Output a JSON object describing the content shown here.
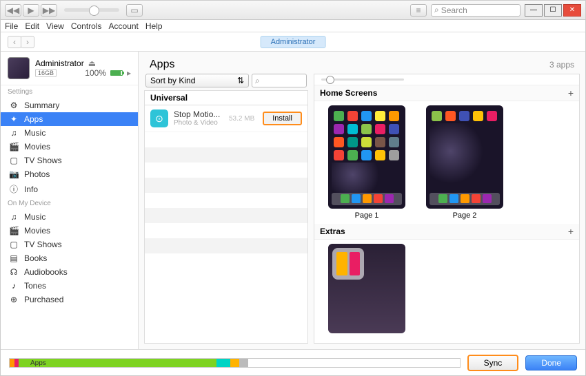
{
  "titlebar": {
    "search_placeholder": "Search"
  },
  "menu": [
    "File",
    "Edit",
    "View",
    "Controls",
    "Account",
    "Help"
  ],
  "context": "Administrator",
  "device": {
    "name": "Administrator",
    "capacity": "16GB",
    "battery": "100%"
  },
  "sidebar": {
    "settings_label": "Settings",
    "settings": [
      {
        "icon": "⚙",
        "label": "Summary"
      },
      {
        "icon": "✦",
        "label": "Apps",
        "active": true
      },
      {
        "icon": "♫",
        "label": "Music"
      },
      {
        "icon": "🎬",
        "label": "Movies"
      },
      {
        "icon": "▢",
        "label": "TV Shows"
      },
      {
        "icon": "📷",
        "label": "Photos"
      },
      {
        "icon": "ⓘ",
        "label": "Info"
      }
    ],
    "device_label": "On My Device",
    "device_items": [
      {
        "icon": "♫",
        "label": "Music"
      },
      {
        "icon": "🎬",
        "label": "Movies"
      },
      {
        "icon": "▢",
        "label": "TV Shows"
      },
      {
        "icon": "▤",
        "label": "Books"
      },
      {
        "icon": "☊",
        "label": "Audiobooks"
      },
      {
        "icon": "♪",
        "label": "Tones"
      },
      {
        "icon": "⊕",
        "label": "Purchased"
      }
    ]
  },
  "content": {
    "title": "Apps",
    "count": "3 apps",
    "sort": "Sort by Kind",
    "group": "Universal",
    "app": {
      "name": "Stop Motio...",
      "category": "Photo & Video",
      "size": "53.2 MB",
      "action": "Install"
    },
    "home_label": "Home Screens",
    "pages": [
      "Page 1",
      "Page 2"
    ],
    "extras_label": "Extras"
  },
  "footer": {
    "storage_label": "Apps",
    "sync": "Sync",
    "done": "Done"
  }
}
